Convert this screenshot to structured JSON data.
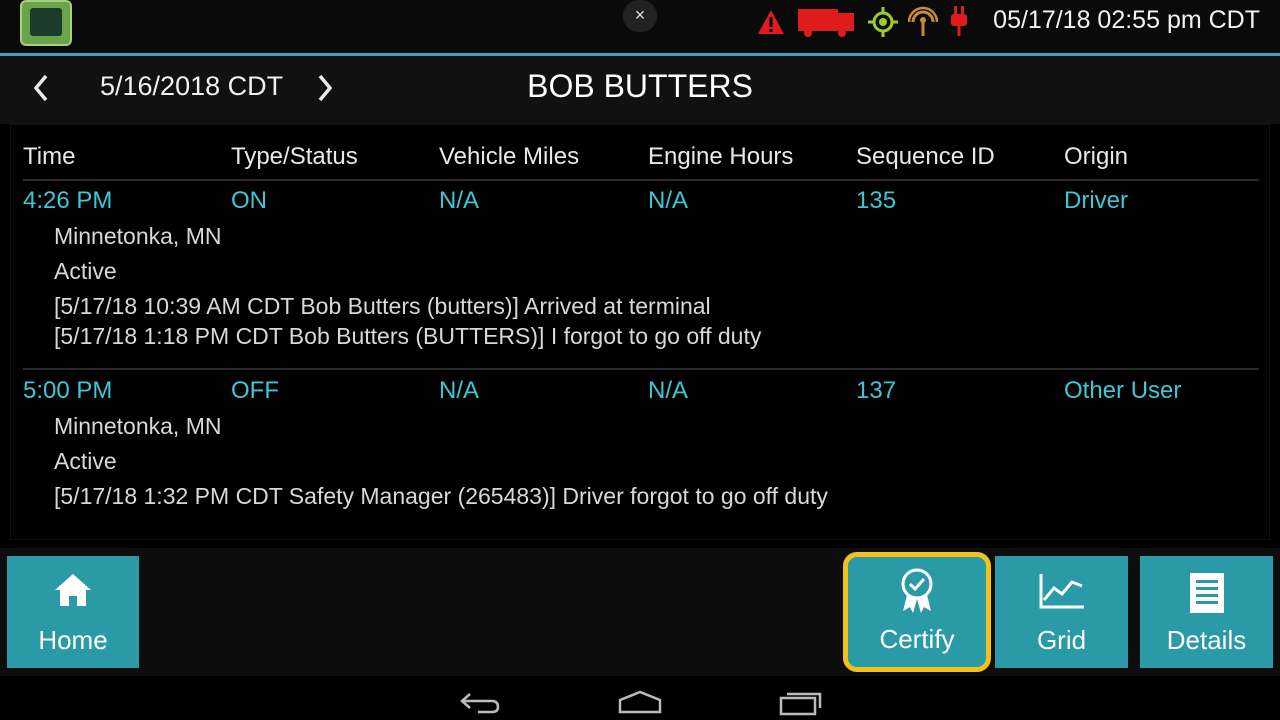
{
  "statusbar": {
    "clock": "05/17/18 02:55 pm CDT",
    "close_glyph": "×",
    "icons": [
      "warning-icon",
      "truck-icon",
      "gps-icon",
      "signal-icon",
      "power-plug-icon"
    ],
    "colors": {
      "accent": "#3aa6c4",
      "warning": "#e01b1b",
      "gps": "#9ccc2c",
      "signal": "#c78a3a"
    }
  },
  "header": {
    "date": "5/16/2018 CDT",
    "driver": "BOB BUTTERS"
  },
  "log": {
    "columns": [
      "Time",
      "Type/Status",
      "Vehicle Miles",
      "Engine Hours",
      "Sequence ID",
      "Origin"
    ],
    "entries": [
      {
        "time": "4:26 PM",
        "status": "ON",
        "miles": "N/A",
        "hours": "N/A",
        "sequence": "135",
        "origin": "Driver",
        "location": "Minnetonka, MN",
        "state": "Active",
        "notes": [
          "[5/17/18 10:39 AM CDT Bob Butters (butters)] Arrived at terminal",
          "[5/17/18 1:18 PM CDT Bob Butters (BUTTERS)] I forgot to go off duty"
        ]
      },
      {
        "time": "5:00 PM",
        "status": "OFF",
        "miles": "N/A",
        "hours": "N/A",
        "sequence": "137",
        "origin": "Other User",
        "location": "Minnetonka, MN",
        "state": "Active",
        "notes": [
          "[5/17/18 1:32 PM CDT Safety Manager (265483)] Driver forgot to go off duty"
        ]
      }
    ],
    "colors": {
      "value": "#3ec7d4"
    }
  },
  "toolbar": {
    "home": "Home",
    "certify": "Certify",
    "grid": "Grid",
    "details": "Details",
    "colors": {
      "button": "#2b9aa7",
      "highlight": "#f2c21b"
    }
  }
}
